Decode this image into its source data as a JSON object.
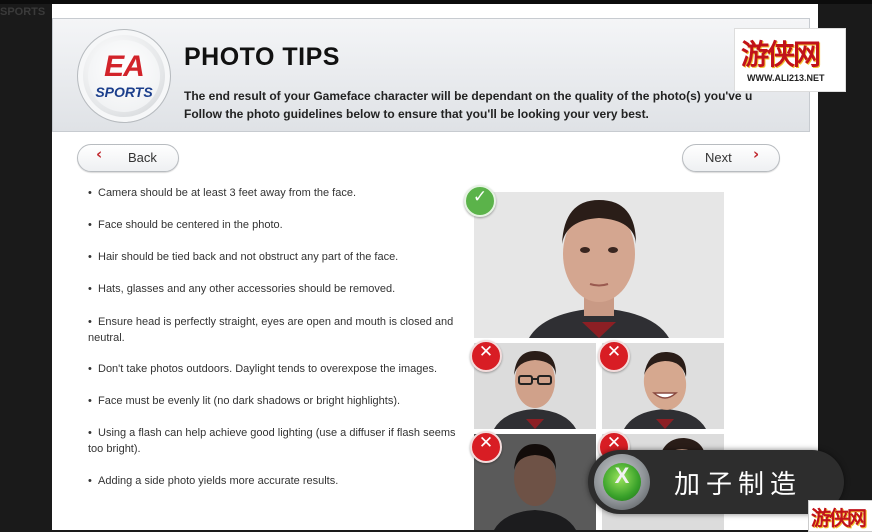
{
  "background": {
    "logo_text": "SPORTS"
  },
  "header": {
    "title": "PHOTO TIPS",
    "subtitle_line1": "The end result of your Gameface character will be dependant on the quality of the photo(s) you've u",
    "subtitle_line2": "Follow the photo guidelines below to ensure that you'll be looking your very best.",
    "logo": {
      "mark": "EA",
      "sub": "SPORTS"
    }
  },
  "nav": {
    "back_label": "Back",
    "next_label": "Next",
    "back_icon": "chevron-left-icon",
    "next_icon": "chevron-right-icon"
  },
  "tips": [
    "Camera should be at least 3 feet away from the face.",
    "Face should be centered in the photo.",
    "Hair should be tied back and not obstruct any part of the face.",
    "Hats, glasses and any other accessories should be removed.",
    "Ensure head is perfectly straight, eyes are open and mouth is closed and neutral.",
    "Don't take photos outdoors. Daylight tends to overexpose the images.",
    "Face must be evenly lit (no dark shadows or bright highlights).",
    "Using a flash can help achieve good lighting (use a diffuser if flash seems too bright).",
    "Adding a side photo yields more accurate results."
  ],
  "tip_bullet": "•",
  "examples": {
    "good": {
      "badge": "✓",
      "icon": "check-icon",
      "color": "#5bb34a"
    },
    "bad": [
      {
        "badge": "✕",
        "icon": "x-icon",
        "depicts": "glasses"
      },
      {
        "badge": "✕",
        "icon": "x-icon",
        "depicts": "smiling"
      },
      {
        "badge": "✕",
        "icon": "x-icon",
        "depicts": "dark lighting"
      },
      {
        "badge": "✕",
        "icon": "x-icon",
        "depicts": "cropped"
      }
    ],
    "bad_color": "#d81d24"
  },
  "watermark": {
    "cn": "游侠网",
    "url": "WWW.ALI213.NET"
  },
  "overlay": {
    "text": "加子制造",
    "icon": "xbox-logo-icon",
    "icon_char": "X"
  },
  "accent_color": "#c0272d"
}
